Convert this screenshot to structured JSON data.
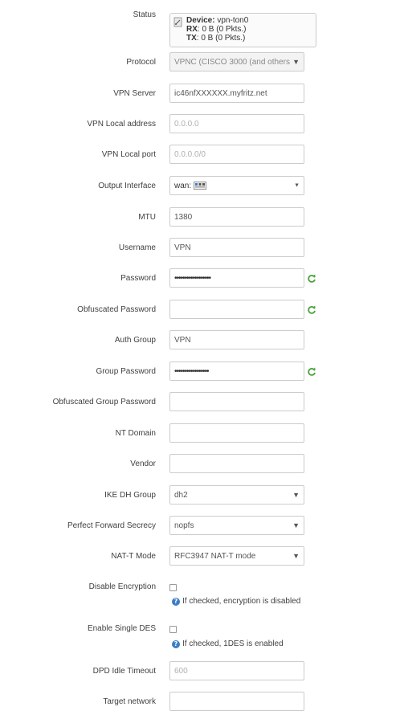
{
  "status": {
    "label": "Status",
    "device_key": "Device:",
    "device_val": "vpn-ton0",
    "rx_key": "RX",
    "rx_val": ": 0 B (0 Pkts.)",
    "tx_key": "TX",
    "tx_val": ": 0 B (0 Pkts.)"
  },
  "protocol": {
    "label": "Protocol",
    "value": "VPNC (CISCO 3000 (and others"
  },
  "vpn_server": {
    "label": "VPN Server",
    "value": "ic46nfXXXXXX.myfritz.net"
  },
  "vpn_local_address": {
    "label": "VPN Local address",
    "placeholder": "0.0.0.0"
  },
  "vpn_local_port": {
    "label": "VPN Local port",
    "placeholder": "0.0.0.0/0"
  },
  "output_interface": {
    "label": "Output Interface",
    "value": "wan:"
  },
  "mtu": {
    "label": "MTU",
    "value": "1380"
  },
  "username": {
    "label": "Username",
    "value": "VPN"
  },
  "password": {
    "label": "Password",
    "value": "••••••••••••••••••"
  },
  "obfuscated_password": {
    "label": "Obfuscated Password",
    "value": ""
  },
  "auth_group": {
    "label": "Auth Group",
    "value": "VPN"
  },
  "group_password": {
    "label": "Group Password",
    "value": "•••••••••••••••••"
  },
  "obfuscated_group_password": {
    "label": "Obfuscated Group Password",
    "value": ""
  },
  "nt_domain": {
    "label": "NT Domain",
    "value": ""
  },
  "vendor": {
    "label": "Vendor",
    "value": ""
  },
  "ike_dh_group": {
    "label": "IKE DH Group",
    "value": "dh2"
  },
  "pfs": {
    "label": "Perfect Forward Secrecy",
    "value": "nopfs"
  },
  "natt_mode": {
    "label": "NAT-T Mode",
    "value": "RFC3947 NAT-T mode"
  },
  "disable_encryption": {
    "label": "Disable Encryption",
    "checked": false,
    "hint": "If checked, encryption is disabled"
  },
  "single_des": {
    "label": "Enable Single DES",
    "checked": false,
    "hint": "If checked, 1DES is enabled"
  },
  "dpd_idle_timeout": {
    "label": "DPD Idle Timeout",
    "placeholder": "600"
  },
  "target_network": {
    "label": "Target network",
    "value": ""
  },
  "icons": {
    "refresh": "refresh-icon",
    "info": "info-icon",
    "device": "network-device-icon"
  },
  "colors": {
    "refresh_green": "#4aa33a",
    "info_blue": "#3a7ec6",
    "border": "#cccccc"
  }
}
